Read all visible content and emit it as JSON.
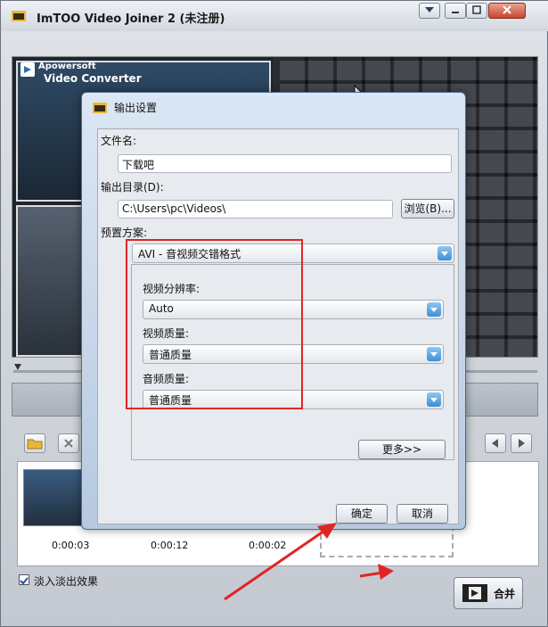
{
  "window": {
    "title": "ImTOO Video Joiner 2 (未注册)"
  },
  "preview": {
    "logo_line1": "Apowersoft",
    "logo_line2": "Video Converter"
  },
  "timeline": {
    "times": [
      "0:00:03",
      "0:00:12",
      "0:00:02"
    ]
  },
  "options": {
    "fade_label": "淡入淡出效果",
    "fade_checked": true,
    "merge_label": "合并"
  },
  "dialog": {
    "title": "输出设置",
    "filename_label": "文件名:",
    "filename_value": "下载吧",
    "output_dir_label": "输出目录(D):",
    "output_dir_value": "C:\\Users\\pc\\Videos\\",
    "browse_label": "浏览(B)...",
    "preset_label": "预置方案:",
    "preset_value": "AVI - 音视频交错格式",
    "resolution_label": "视频分辨率:",
    "resolution_value": "Auto",
    "video_quality_label": "视频质量:",
    "video_quality_value": "普通质量",
    "audio_quality_label": "音频质量:",
    "audio_quality_value": "普通质量",
    "more_label": "更多>>",
    "ok_label": "确定",
    "cancel_label": "取消"
  },
  "colors": {
    "highlight": "#e12525",
    "accent": "#3d8fd3"
  }
}
